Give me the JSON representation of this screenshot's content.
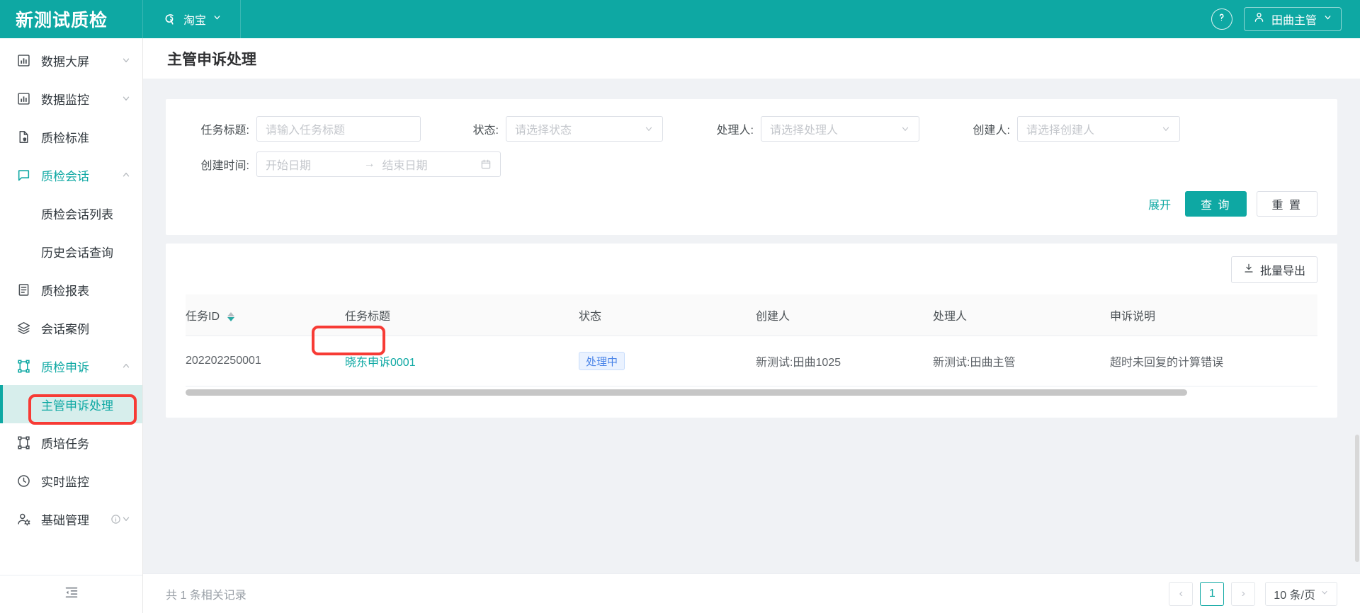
{
  "header": {
    "brand": "新测试质检",
    "shop": {
      "label": "淘宝",
      "icon": "taobao-logo-icon",
      "caret": "chevron-down-icon"
    },
    "help_icon": "question-circle-icon",
    "user": {
      "name": "田曲主管",
      "icon": "user-icon",
      "caret": "chevron-down-icon"
    }
  },
  "sidebar": {
    "items": [
      {
        "label": "数据大屏",
        "icon": "chart-bar-icon",
        "arrow": "chevron-down-icon",
        "state": "collapsed"
      },
      {
        "label": "数据监控",
        "icon": "chart-bar-icon",
        "arrow": "chevron-down-icon",
        "state": "collapsed"
      },
      {
        "label": "质检标准",
        "icon": "file-shield-icon",
        "arrow": "",
        "state": "leaf"
      },
      {
        "label": "质检会话",
        "icon": "chat-bubble-icon",
        "arrow": "chevron-up-icon",
        "state": "expanded"
      },
      {
        "label": "质检会话列表",
        "icon": "",
        "arrow": "",
        "state": "sub"
      },
      {
        "label": "历史会话查询",
        "icon": "",
        "arrow": "",
        "state": "sub"
      },
      {
        "label": "质检报表",
        "icon": "report-doc-icon",
        "arrow": "",
        "state": "leaf"
      },
      {
        "label": "会话案例",
        "icon": "layers-icon",
        "arrow": "",
        "state": "leaf"
      },
      {
        "label": "质检申诉",
        "icon": "frame-icon",
        "arrow": "chevron-up-icon",
        "state": "expanded"
      },
      {
        "label": "主管申诉处理",
        "icon": "",
        "arrow": "",
        "state": "sub-active"
      },
      {
        "label": "质培任务",
        "icon": "frame-icon",
        "arrow": "",
        "state": "leaf"
      },
      {
        "label": "实时监控",
        "icon": "clock-icon",
        "arrow": "",
        "state": "leaf"
      },
      {
        "label": "基础管理",
        "icon": "user-cog-icon",
        "arrow": "chevron-down-icon",
        "info": "info-circle-icon",
        "state": "collapsed"
      }
    ],
    "collapse_icon": "menu-indent-icon"
  },
  "page": {
    "title": "主管申诉处理"
  },
  "filters": {
    "task_title": {
      "label": "任务标题:",
      "placeholder": "请输入任务标题",
      "value": ""
    },
    "status": {
      "label": "状态:",
      "placeholder": "请选择状态",
      "value": ""
    },
    "handler": {
      "label": "处理人:",
      "placeholder": "请选择处理人",
      "value": ""
    },
    "creator": {
      "label": "创建人:",
      "placeholder": "请选择创建人",
      "value": ""
    },
    "create_time": {
      "label": "创建时间:",
      "start_placeholder": "开始日期",
      "end_placeholder": "结束日期",
      "separator": "→",
      "calendar_icon": "calendar-icon"
    },
    "actions": {
      "expand": "展开",
      "search": "查 询",
      "reset": "重 置"
    }
  },
  "toolbar": {
    "export": "批量导出",
    "export_icon": "download-icon"
  },
  "table": {
    "columns": [
      {
        "key": "task_id",
        "label": "任务ID",
        "sortable": true
      },
      {
        "key": "task_title",
        "label": "任务标题",
        "sortable": false
      },
      {
        "key": "status",
        "label": "状态",
        "sortable": false
      },
      {
        "key": "creator",
        "label": "创建人",
        "sortable": false
      },
      {
        "key": "handler",
        "label": "处理人",
        "sortable": false
      },
      {
        "key": "appeal_desc",
        "label": "申诉说明",
        "sortable": false
      }
    ],
    "rows": [
      {
        "task_id": "202202250001",
        "task_title": "晓东申诉0001",
        "status": "处理中",
        "creator": "新测试:田曲1025",
        "handler": "新测试:田曲主管",
        "appeal_desc": "超时未回复的计算错误"
      }
    ]
  },
  "footer": {
    "total_text": "共 1 条相关记录",
    "prev": "‹",
    "next": "›",
    "current_page": "1",
    "page_size": "10 条/页"
  },
  "colors": {
    "brand": "#0ea8a3",
    "active_bg": "#d7eeec",
    "highlight": "#f73b35",
    "badge_text": "#4a84e8",
    "badge_bg": "#eaf2ff"
  }
}
